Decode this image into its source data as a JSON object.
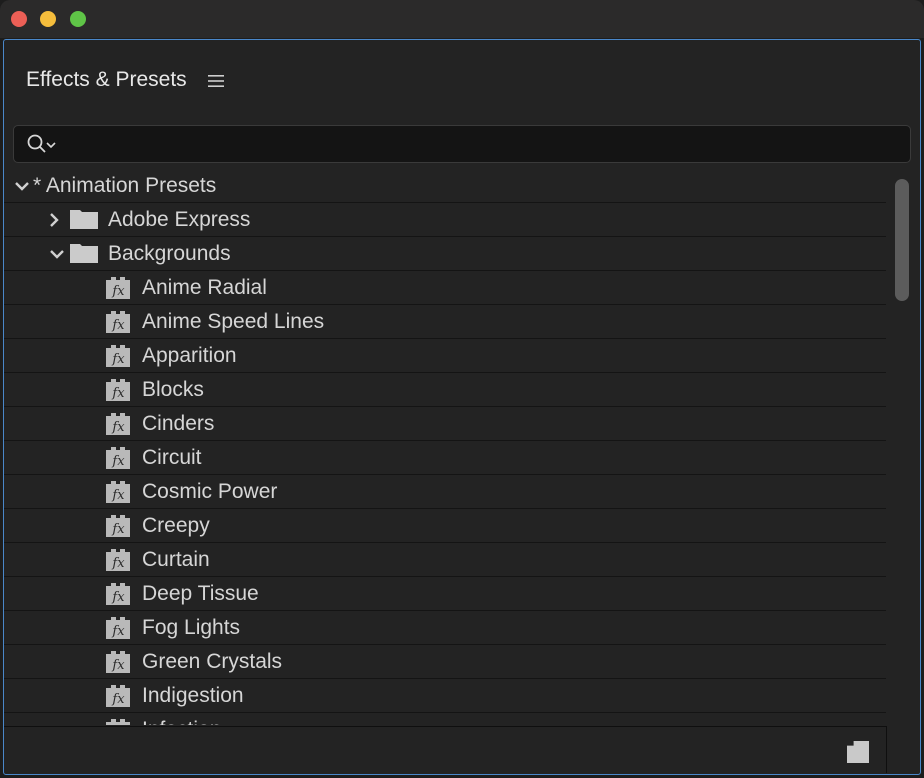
{
  "panel": {
    "title": "Effects & Presets",
    "menu_icon": "hamburger-menu-icon"
  },
  "search": {
    "value": "",
    "placeholder": "",
    "icon": "search-icon"
  },
  "tree": {
    "root": {
      "label": "* Animation Presets",
      "expanded": true
    },
    "folders": [
      {
        "label": "Adobe Express",
        "expanded": false
      },
      {
        "label": "Backgrounds",
        "expanded": true
      }
    ],
    "presets": [
      "Anime Radial",
      "Anime Speed Lines",
      "Apparition",
      "Blocks",
      "Cinders",
      "Circuit",
      "Cosmic Power",
      "Creepy",
      "Curtain",
      "Deep Tissue",
      "Fog Lights",
      "Green Crystals",
      "Indigestion",
      "Infection"
    ]
  },
  "footer": {
    "new_item_icon": "new-item-icon"
  },
  "colors": {
    "accent_border": "#4a87c9",
    "close": "#ec5f56",
    "minimize": "#f5bd3c",
    "maximize": "#5fc447"
  }
}
